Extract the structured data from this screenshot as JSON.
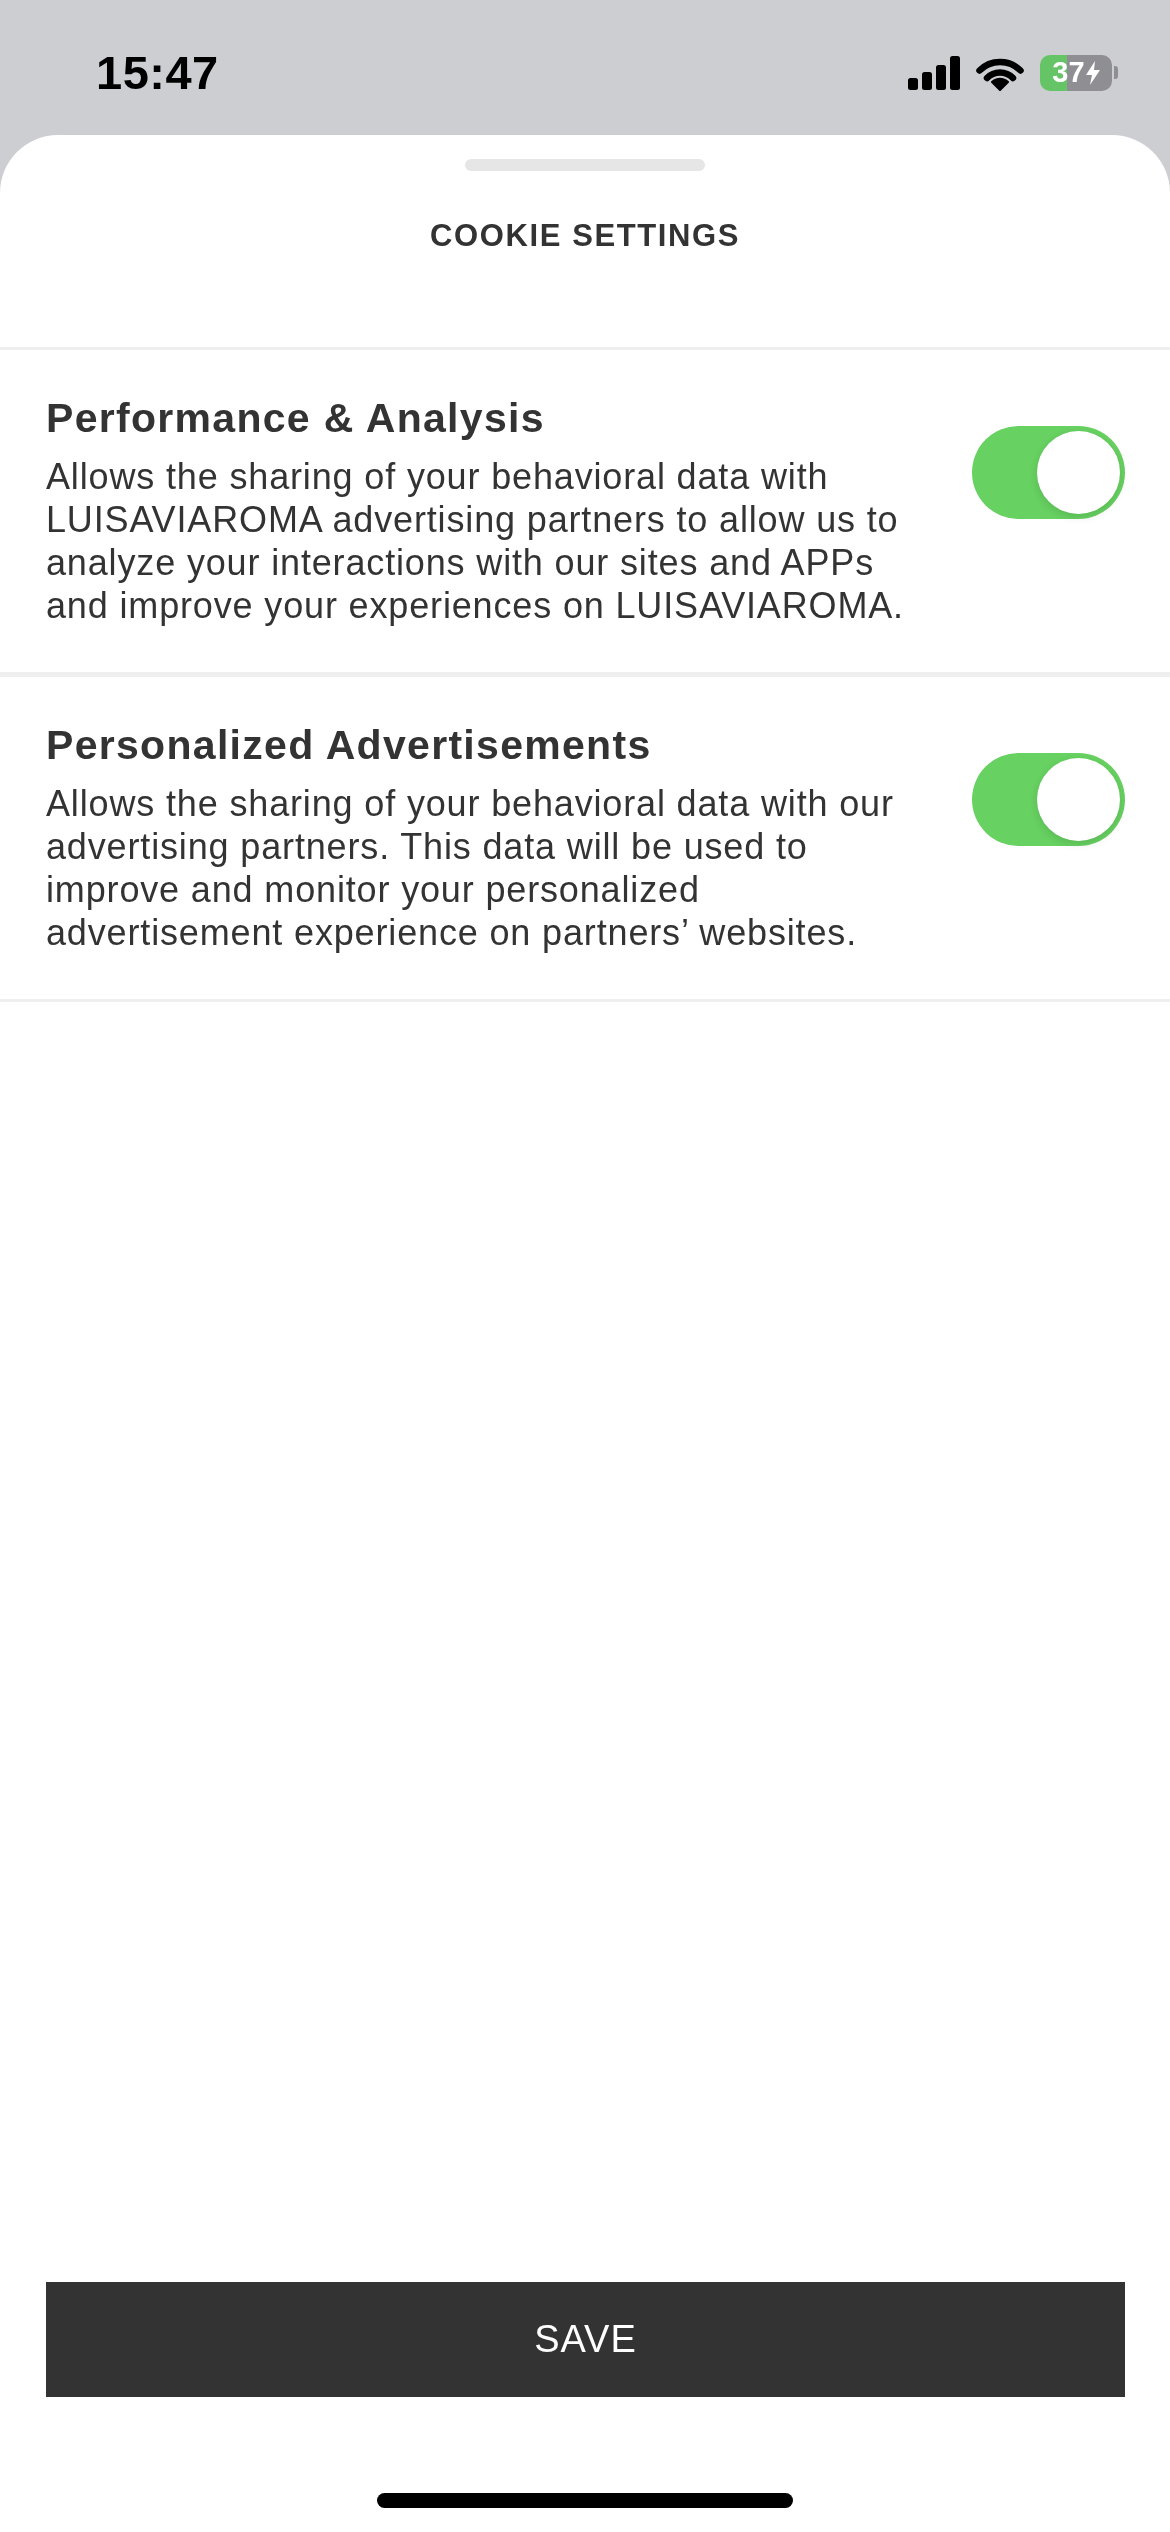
{
  "status_bar": {
    "time": "15:47",
    "battery": "37",
    "charging": true
  },
  "sheet": {
    "title": "COOKIE SETTINGS"
  },
  "settings": [
    {
      "title": "Performance & Analysis",
      "description": "Allows the sharing of your behavioral data with LUISAVIAROMA advertising partners to allow us to analyze your interactions with our sites and APPs and improve your experiences on LUISAVIAROMA.",
      "on": true
    },
    {
      "title": "Personalized Advertisements",
      "description": "Allows the sharing of your behavioral data with our advertising partners. This data will be used to improve and monitor your personalized advertisement experience on partners’ websites.",
      "on": true
    }
  ],
  "save_button": {
    "label": "SAVE"
  }
}
